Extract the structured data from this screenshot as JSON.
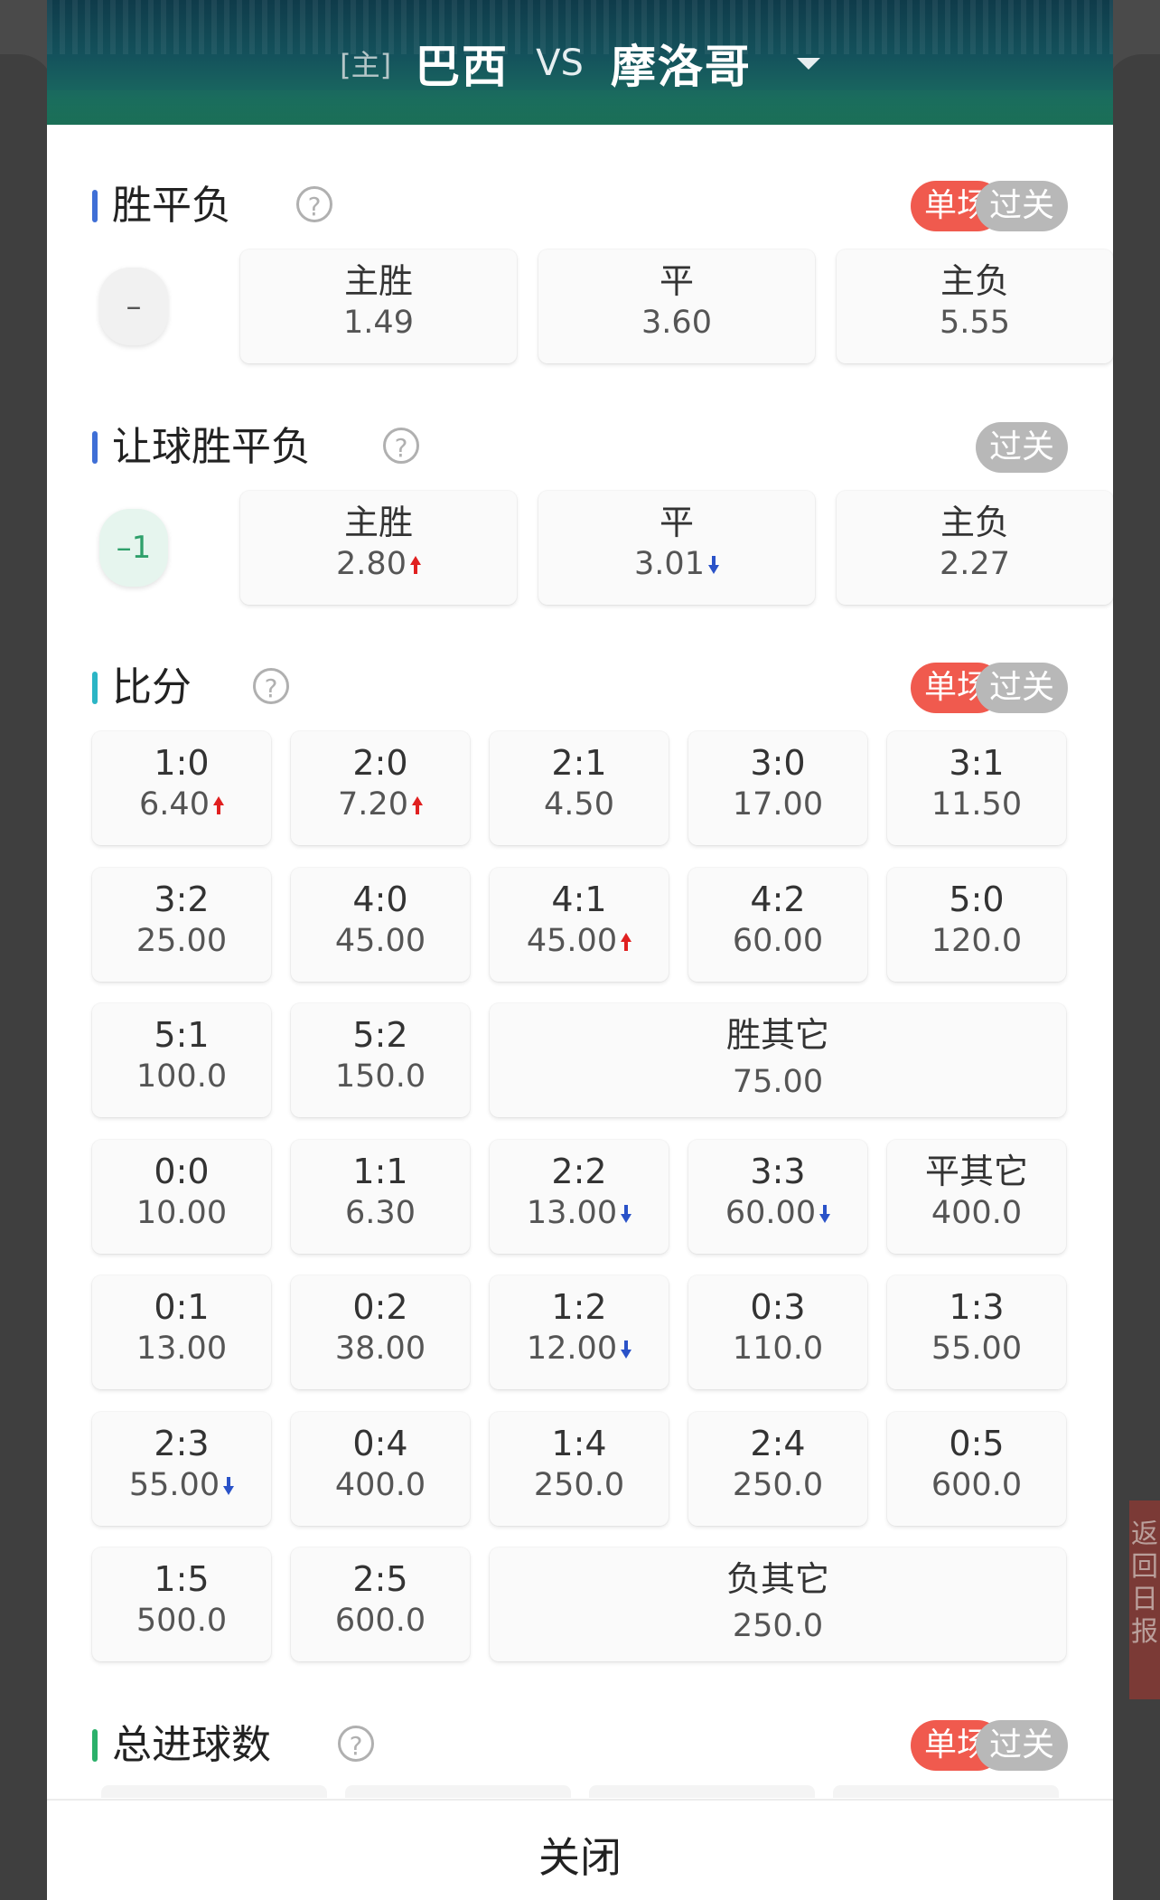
{
  "header": {
    "home_tag": "[主]",
    "home_team": "巴西",
    "vs": "VS",
    "away_team": "摩洛哥"
  },
  "sections": {
    "spf": {
      "title": "胜平负",
      "help": "?",
      "single": "单场",
      "parlay": "过关",
      "handicap": "–",
      "options": [
        {
          "label": "主胜",
          "odds": "1.49"
        },
        {
          "label": "平",
          "odds": "3.60"
        },
        {
          "label": "主负",
          "odds": "5.55"
        }
      ]
    },
    "rqspf": {
      "title": "让球胜平负",
      "help": "?",
      "parlay": "过关",
      "handicap": "–1",
      "options": [
        {
          "label": "主胜",
          "odds": "2.80",
          "trend": "up"
        },
        {
          "label": "平",
          "odds": "3.01",
          "trend": "down"
        },
        {
          "label": "主负",
          "odds": "2.27"
        }
      ]
    },
    "score": {
      "title": "比分",
      "help": "?",
      "single": "单场",
      "parlay": "过关",
      "cells": [
        {
          "label": "1:0",
          "odds": "6.40",
          "trend": "up"
        },
        {
          "label": "2:0",
          "odds": "7.20",
          "trend": "up"
        },
        {
          "label": "2:1",
          "odds": "4.50"
        },
        {
          "label": "3:0",
          "odds": "17.00"
        },
        {
          "label": "3:1",
          "odds": "11.50"
        },
        {
          "label": "3:2",
          "odds": "25.00"
        },
        {
          "label": "4:0",
          "odds": "45.00"
        },
        {
          "label": "4:1",
          "odds": "45.00",
          "trend": "up"
        },
        {
          "label": "4:2",
          "odds": "60.00"
        },
        {
          "label": "5:0",
          "odds": "120.0"
        },
        {
          "label": "5:1",
          "odds": "100.0"
        },
        {
          "label": "5:2",
          "odds": "150.0"
        },
        {
          "label": "胜其它",
          "odds": "75.00"
        },
        {
          "label": "0:0",
          "odds": "10.00"
        },
        {
          "label": "1:1",
          "odds": "6.30"
        },
        {
          "label": "2:2",
          "odds": "13.00",
          "trend": "down"
        },
        {
          "label": "3:3",
          "odds": "60.00",
          "trend": "down"
        },
        {
          "label": "平其它",
          "odds": "400.0"
        },
        {
          "label": "0:1",
          "odds": "13.00"
        },
        {
          "label": "0:2",
          "odds": "38.00"
        },
        {
          "label": "1:2",
          "odds": "12.00",
          "trend": "down"
        },
        {
          "label": "0:3",
          "odds": "110.0"
        },
        {
          "label": "1:3",
          "odds": "55.00"
        },
        {
          "label": "2:3",
          "odds": "55.00",
          "trend": "down"
        },
        {
          "label": "0:4",
          "odds": "400.0"
        },
        {
          "label": "1:4",
          "odds": "250.0"
        },
        {
          "label": "2:4",
          "odds": "250.0"
        },
        {
          "label": "0:5",
          "odds": "600.0"
        },
        {
          "label": "1:5",
          "odds": "500.0"
        },
        {
          "label": "2:5",
          "odds": "600.0"
        },
        {
          "label": "负其它",
          "odds": "250.0"
        }
      ]
    },
    "total": {
      "title": "总进球数",
      "help": "?",
      "single": "单场",
      "parlay": "过关"
    }
  },
  "side_tab": "返回日报",
  "close_label": "关闭",
  "colors": {
    "up": "#e02020",
    "down": "#2a52c8",
    "accent_red": "#f05a4e",
    "bar_blue": "#3f6fd6",
    "bar_teal": "#2bb5c5",
    "bar_green": "#2bb06a"
  }
}
